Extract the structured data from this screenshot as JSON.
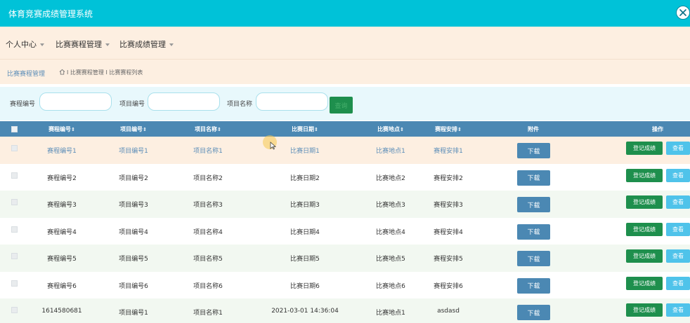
{
  "app": {
    "title": "体育竞赛成绩管理系统"
  },
  "menu": [
    {
      "label": "个人中心"
    },
    {
      "label": "比赛赛程管理"
    },
    {
      "label": "比赛成绩管理"
    }
  ],
  "breadcrumb": {
    "title": "比赛赛程管理",
    "path": "I 比赛赛程管理 I 比赛赛程列表"
  },
  "search": {
    "fields": [
      {
        "label": "赛程编号",
        "value": ""
      },
      {
        "label": "项目编号",
        "value": ""
      },
      {
        "label": "项目名称",
        "value": ""
      }
    ],
    "button_label": "查询"
  },
  "table": {
    "columns": [
      "赛程编号",
      "项目编号",
      "项目名称",
      "比赛日期",
      "比赛地点",
      "赛程安排",
      "附件",
      "操作"
    ],
    "sortable": [
      true,
      true,
      true,
      true,
      true,
      true,
      false,
      false
    ],
    "actions": {
      "download": "下载",
      "register": "登记成绩",
      "view": "查看"
    },
    "rows": [
      [
        "赛程编号1",
        "项目编号1",
        "项目名称1",
        "比赛日期1",
        "比赛地点1",
        "赛程安排1"
      ],
      [
        "赛程编号2",
        "项目编号2",
        "项目名称2",
        "比赛日期2",
        "比赛地点2",
        "赛程安排2"
      ],
      [
        "赛程编号3",
        "项目编号3",
        "项目名称3",
        "比赛日期3",
        "比赛地点3",
        "赛程安排3"
      ],
      [
        "赛程编号4",
        "项目编号4",
        "项目名称4",
        "比赛日期4",
        "比赛地点4",
        "赛程安排4"
      ],
      [
        "赛程编号5",
        "项目编号5",
        "项目名称5",
        "比赛日期5",
        "比赛地点5",
        "赛程安排5"
      ],
      [
        "赛程编号6",
        "项目编号6",
        "项目名称6",
        "比赛日期6",
        "比赛地点6",
        "赛程安排6"
      ],
      [
        "1614580681",
        "项目编号1",
        "项目名称1",
        "2021-03-01 14:36:04",
        "比赛地点1",
        "asdasd"
      ]
    ]
  },
  "colors": {
    "header": "#00c2d8",
    "menu_bg": "#fdefe1",
    "table_header": "#4b88b3",
    "primary_green": "#1e8f4d",
    "view_blue": "#4fc3ea"
  },
  "icons": {
    "close": "close-icon",
    "caret": "caret-down-icon",
    "home": "home-icon",
    "cursor": "mouse-cursor-icon"
  }
}
